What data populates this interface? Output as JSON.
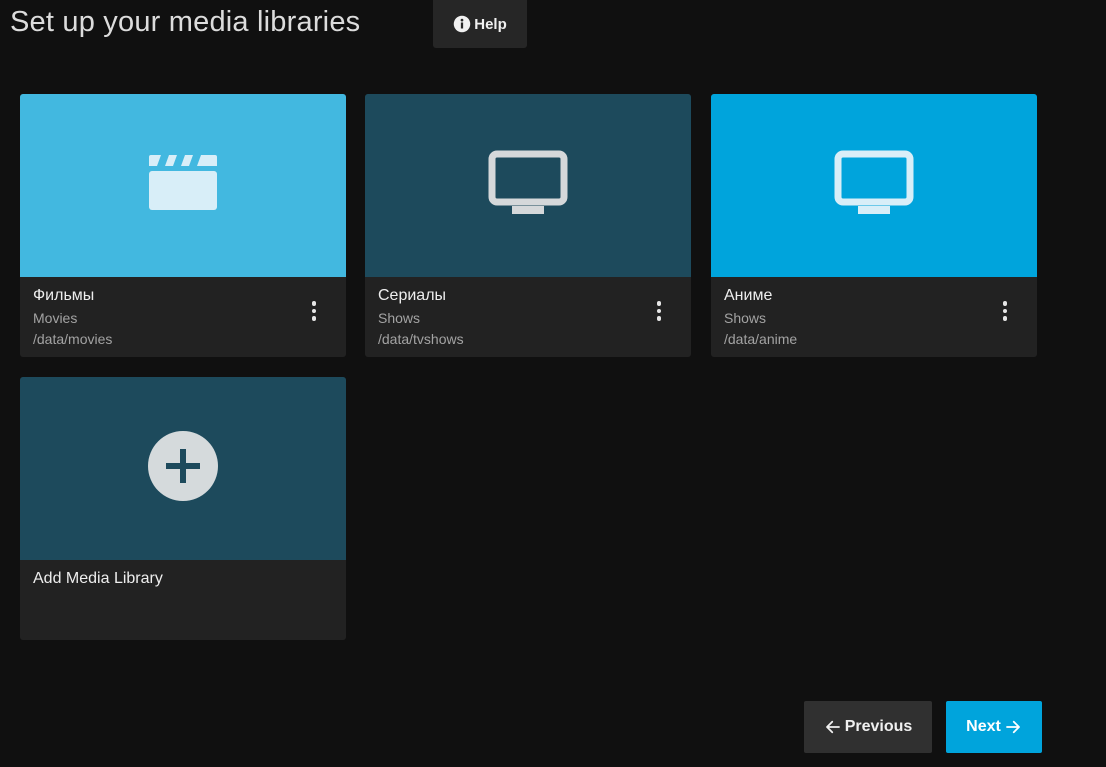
{
  "page": {
    "title": "Set up your media libraries",
    "help_label": "Help"
  },
  "colors": {
    "background": "#101010",
    "card_footer": "#222222",
    "accent": "#00a4dc",
    "movies_tile": "#42b8e0",
    "dark_teal_tile": "#1d4a5c",
    "icon_light": "#d8eef8"
  },
  "libraries": [
    {
      "name": "Фильмы",
      "type": "Movies",
      "path": "/data/movies",
      "icon": "clapperboard-icon",
      "color": "#42b8e0"
    },
    {
      "name": "Сериалы",
      "type": "Shows",
      "path": "/data/tvshows",
      "icon": "tv-icon",
      "color": "#1d4a5c"
    },
    {
      "name": "Аниме",
      "type": "Shows",
      "path": "/data/anime",
      "icon": "tv-icon",
      "color": "#00a4dc"
    }
  ],
  "add_library": {
    "label": "Add Media Library",
    "icon": "plus-circle-icon",
    "color": "#1d4a5c"
  },
  "footer": {
    "previous_label": "Previous",
    "next_label": "Next"
  }
}
